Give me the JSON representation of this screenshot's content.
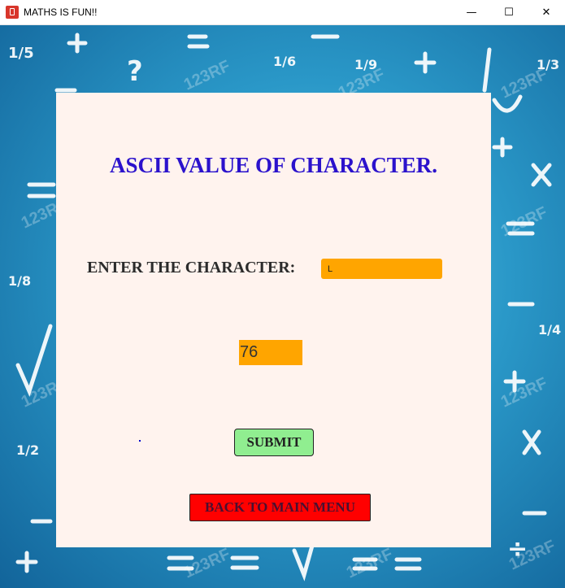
{
  "window": {
    "title": "MATHS IS FUN!!",
    "minimize_glyph": "—",
    "maximize_glyph": "☐",
    "close_glyph": "✕"
  },
  "panel": {
    "heading": "ASCII VALUE OF CHARACTER.",
    "character_label": "ENTER THE CHARACTER:",
    "character_value": "L",
    "result_value": "76"
  },
  "buttons": {
    "submit_label": "SUBMIT",
    "back_label": "BACK TO MAIN MENU"
  },
  "background": {
    "symbols": [
      "1/5",
      "+",
      "?",
      "=",
      "1/6",
      "1/9",
      "+",
      "1/3",
      "X",
      "1/8",
      "√",
      "1/4",
      "+",
      "1/2",
      "X",
      "÷",
      "=",
      "√",
      "+",
      "-"
    ],
    "watermark": "123RF"
  },
  "colors": {
    "heading": "#2b12cc",
    "input_fill": "#ffa500",
    "submit": "#90ee90",
    "back": "#ff0000",
    "panel": "#fff3ee"
  }
}
